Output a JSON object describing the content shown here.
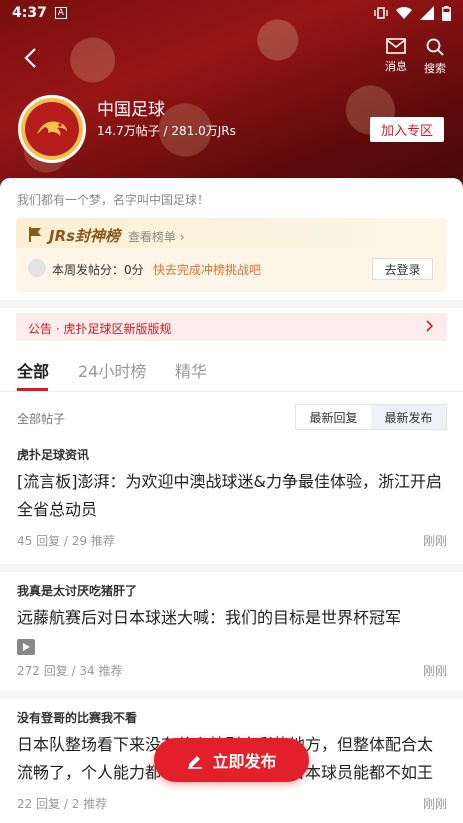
{
  "status_bar": {
    "time": "4:37",
    "notif_letter": "A"
  },
  "nav": {
    "messages_label": "消息",
    "search_label": "搜索"
  },
  "forum": {
    "name": "中国足球",
    "stats": "14.7万帖子 / 281.0万JRs",
    "join_label": "加入专区",
    "slogan": "我们都有一个梦，名字叫中国足球！"
  },
  "ranking": {
    "title": "JRs封神榜",
    "view_more": "查看榜单 ›",
    "score_text": "本周发帖分：0分",
    "cta_text": "快去完成冲榜挑战吧",
    "login_label": "去登录"
  },
  "notice": {
    "text": "公告 · 虎扑足球区新版版规"
  },
  "tabs": [
    {
      "label": "全部"
    },
    {
      "label": "24小时榜"
    },
    {
      "label": "精华"
    }
  ],
  "list": {
    "header": "全部帖子",
    "sort_options": [
      "最新回复",
      "最新发布"
    ]
  },
  "posts": [
    {
      "tag": "虎扑足球资讯",
      "title": "[流言板]澎湃：为欢迎中澳战球迷&力争最佳体验，浙江开启全省总动员",
      "meta": "45 回复 / 29 推荐",
      "time": "刚刚"
    },
    {
      "tag": "我真是太讨厌吃猪肝了",
      "title": "远藤航赛后对日本球迷大喊：我们的目标是世界杯冠军",
      "meta": "272 回复 / 34 推荐",
      "time": "刚刚",
      "video_icon": "play-video-icon"
    },
    {
      "tag": "没有登哥的比赛我不看",
      "title": "日本队整场看下来没有什么特别出彩的地方，但整体配合太流畅了，个人能力都一般，估计大部分日本球员能都不如王玉栋，…",
      "meta": "22 回复 / 2 推荐",
      "time": "刚刚"
    }
  ],
  "publish_label": "立即发布",
  "colors": {
    "brand_red": "#d01d25",
    "accent_orange": "#e0722d"
  }
}
